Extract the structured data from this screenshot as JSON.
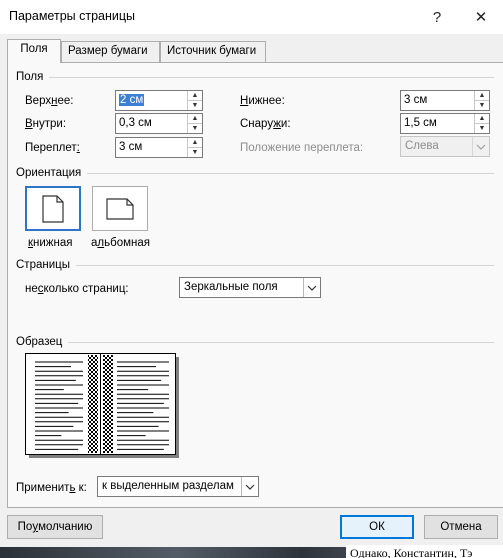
{
  "window": {
    "title": "Параметры страницы",
    "help_glyph": "?",
    "close_glyph": "✕"
  },
  "tabs": [
    "Поля",
    "Размер бумаги",
    "Источник бумаги"
  ],
  "margins": {
    "section_title": "Поля",
    "top": {
      "label_pre": "Верх",
      "label_ul": "н",
      "label_post": "ее:",
      "value": "2 см"
    },
    "bottom": {
      "label_pre": "",
      "label_ul": "Н",
      "label_post": "ижнее:",
      "value": "3 см"
    },
    "inside": {
      "label_pre": "",
      "label_ul": "В",
      "label_post": "нутри:",
      "value": "0,3 см"
    },
    "outside": {
      "label_pre": "Снару",
      "label_ul": "ж",
      "label_post": "и:",
      "value": "1,5 см"
    },
    "gutter": {
      "label_pre": "Переплет",
      "label_ul": ":",
      "label_post": "",
      "value": "3 см"
    },
    "gutter_position": {
      "label": "Положение переплета:",
      "value": "Слева"
    }
  },
  "orientation": {
    "section_title": "Ориентация",
    "portrait": {
      "label_ul": "к",
      "label_post": "нижная"
    },
    "landscape": {
      "label_pre": "а",
      "label_ul": "л",
      "label_post": "ьбомная"
    },
    "selected": "portrait"
  },
  "pages": {
    "section_title": "Страницы",
    "multiple_label_pre": "не",
    "multiple_label_ul": "с",
    "multiple_label_post": "колько страниц:",
    "multiple_value": "Зеркальные поля"
  },
  "preview": {
    "section_title": "Образец"
  },
  "apply_to": {
    "label_pre": "Применит",
    "label_ul": "ь",
    "label_post": " к:",
    "value": "к выделенным разделам"
  },
  "buttons": {
    "default_pre": "По ",
    "default_ul": "у",
    "default_post": "молчанию",
    "ok": "ОК",
    "cancel": "Отмена"
  },
  "background_text": "Однако, Константин, Тэ"
}
